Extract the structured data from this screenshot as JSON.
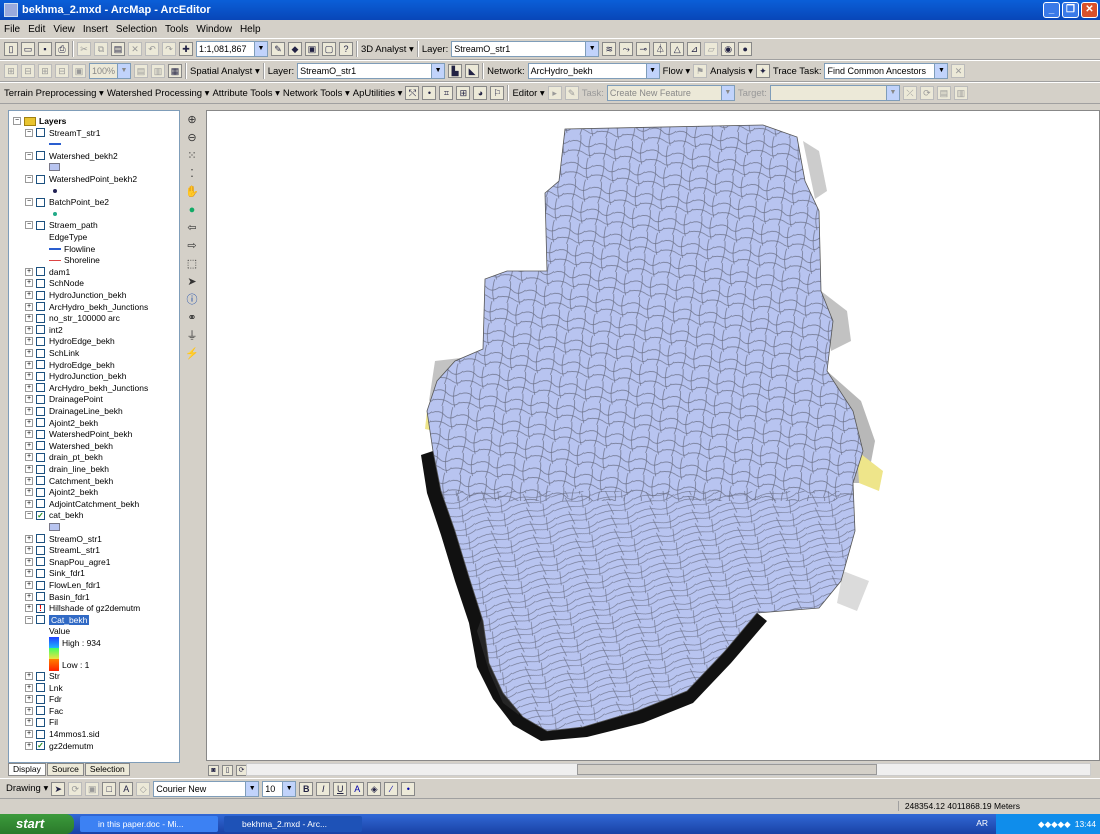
{
  "window": {
    "title": "bekhma_2.mxd - ArcMap - ArcEditor"
  },
  "menu": [
    "File",
    "Edit",
    "View",
    "Insert",
    "Selection",
    "Tools",
    "Window",
    "Help"
  ],
  "toolbar1": {
    "scale": "1:1,081,867",
    "analyst3d": "3D Analyst ▾",
    "layer_label": "Layer:",
    "layer_value": "StreamO_str1"
  },
  "toolbar2": {
    "zoom": "100%",
    "spatial_analyst": "Spatial Analyst ▾",
    "layer_label": "Layer:",
    "layer_value": "StreamO_str1",
    "network_label": "Network:",
    "network_value": "ArcHydro_bekh",
    "flow": "Flow ▾",
    "analysis": "Analysis ▾",
    "trace_label": "Trace Task:",
    "trace_value": "Find Common Ancestors"
  },
  "toolbar3": {
    "terrain": "Terrain Preprocessing ▾",
    "watershed": "Watershed Processing ▾",
    "attribute": "Attribute Tools ▾",
    "network": "Network Tools ▾",
    "aputilities": "ApUtilities ▾",
    "editor": "Editor ▾",
    "task_label": "Task:",
    "task_value": "Create New Feature",
    "target_label": "Target:"
  },
  "toc": {
    "rows": [
      {
        "t": "root",
        "label": "Layers",
        "exp": "−"
      },
      {
        "t": "layer",
        "label": "StreamT_str1",
        "exp": "−",
        "chk": ""
      },
      {
        "t": "sym",
        "label": "",
        "sym": "line-blue"
      },
      {
        "t": "layer",
        "label": "Watershed_bekh2",
        "exp": "−",
        "chk": ""
      },
      {
        "t": "sym",
        "label": "",
        "sym": "box-blue"
      },
      {
        "t": "layer",
        "label": "WatershedPoint_bekh2",
        "exp": "−",
        "chk": ""
      },
      {
        "t": "sym",
        "label": "",
        "sym": "dot"
      },
      {
        "t": "layer",
        "label": "BatchPoint_be2",
        "exp": "−",
        "chk": ""
      },
      {
        "t": "sym",
        "label": "",
        "sym": "dot-green"
      },
      {
        "t": "layer",
        "label": "Straem_path",
        "exp": "−",
        "chk": ""
      },
      {
        "t": "sub",
        "label": "EdgeType"
      },
      {
        "t": "sym",
        "label": "Flowline",
        "sym": "line-blue"
      },
      {
        "t": "sym",
        "label": "Shoreline",
        "sym": "line-red"
      },
      {
        "t": "layer",
        "label": "dam1",
        "exp": "+",
        "chk": ""
      },
      {
        "t": "layer",
        "label": "SchNode",
        "exp": "+",
        "chk": ""
      },
      {
        "t": "layer",
        "label": "HydroJunction_bekh",
        "exp": "+",
        "chk": ""
      },
      {
        "t": "layer",
        "label": "ArcHydro_bekh_Junctions",
        "exp": "+",
        "chk": ""
      },
      {
        "t": "layer",
        "label": "no_str_100000 arc",
        "exp": "+",
        "chk": ""
      },
      {
        "t": "layer",
        "label": "int2",
        "exp": "+",
        "chk": ""
      },
      {
        "t": "layer",
        "label": "HydroEdge_bekh",
        "exp": "+",
        "chk": ""
      },
      {
        "t": "layer",
        "label": "SchLink",
        "exp": "+",
        "chk": ""
      },
      {
        "t": "layer",
        "label": "HydroEdge_bekh",
        "exp": "+",
        "chk": ""
      },
      {
        "t": "layer",
        "label": "HydroJunction_bekh",
        "exp": "+",
        "chk": ""
      },
      {
        "t": "layer",
        "label": "ArcHydro_bekh_Junctions",
        "exp": "+",
        "chk": ""
      },
      {
        "t": "layer",
        "label": "DrainagePoint",
        "exp": "+",
        "chk": ""
      },
      {
        "t": "layer",
        "label": "DrainageLine_bekh",
        "exp": "+",
        "chk": ""
      },
      {
        "t": "layer",
        "label": "Ajoint2_bekh",
        "exp": "+",
        "chk": ""
      },
      {
        "t": "layer",
        "label": "WatershedPoint_bekh",
        "exp": "+",
        "chk": ""
      },
      {
        "t": "layer",
        "label": "Watershed_bekh",
        "exp": "+",
        "chk": ""
      },
      {
        "t": "layer",
        "label": "drain_pt_bekh",
        "exp": "+",
        "chk": ""
      },
      {
        "t": "layer",
        "label": "drain_line_bekh",
        "exp": "+",
        "chk": ""
      },
      {
        "t": "layer",
        "label": "Catchment_bekh",
        "exp": "+",
        "chk": ""
      },
      {
        "t": "layer",
        "label": "Ajoint2_bekh",
        "exp": "+",
        "chk": ""
      },
      {
        "t": "layer",
        "label": "AdjointCatchment_bekh",
        "exp": "+",
        "chk": ""
      },
      {
        "t": "layer",
        "label": "cat_bekh",
        "exp": "−",
        "chk": "✓"
      },
      {
        "t": "sym",
        "label": "",
        "sym": "box-blue"
      },
      {
        "t": "layer",
        "label": "StreamO_str1",
        "exp": "+",
        "chk": ""
      },
      {
        "t": "layer",
        "label": "StreamL_str1",
        "exp": "+",
        "chk": ""
      },
      {
        "t": "layer",
        "label": "SnapPou_agre1",
        "exp": "+",
        "chk": ""
      },
      {
        "t": "layer",
        "label": "Sink_fdr1",
        "exp": "+",
        "chk": ""
      },
      {
        "t": "layer",
        "label": "FlowLen_fdr1",
        "exp": "+",
        "chk": ""
      },
      {
        "t": "layer",
        "label": "Basin_fdr1",
        "exp": "+",
        "chk": ""
      },
      {
        "t": "layer",
        "label": "Hillshade of gz2demutm",
        "exp": "+",
        "chk": "!"
      },
      {
        "t": "layer",
        "label": "Cat_bekh",
        "exp": "−",
        "chk": "",
        "sel": true
      },
      {
        "t": "sub",
        "label": "Value"
      },
      {
        "t": "ramp",
        "label": "High : 934"
      },
      {
        "t": "ramp2",
        "label": ""
      },
      {
        "t": "ramp3",
        "label": "Low : 1"
      },
      {
        "t": "layer",
        "label": "Str",
        "exp": "+",
        "chk": ""
      },
      {
        "t": "layer",
        "label": "Lnk",
        "exp": "+",
        "chk": ""
      },
      {
        "t": "layer",
        "label": "Fdr",
        "exp": "+",
        "chk": ""
      },
      {
        "t": "layer",
        "label": "Fac",
        "exp": "+",
        "chk": ""
      },
      {
        "t": "layer",
        "label": "Fil",
        "exp": "+",
        "chk": ""
      },
      {
        "t": "layer",
        "label": "14mmos1.sid",
        "exp": "+",
        "chk": ""
      },
      {
        "t": "layer",
        "label": "gz2demutm",
        "exp": "+",
        "chk": "✓"
      }
    ]
  },
  "tabs": [
    "Display",
    "Source",
    "Selection"
  ],
  "draw": {
    "drawing": "Drawing ▾",
    "font": "Courier New",
    "size": "10"
  },
  "status": {
    "coords": "248354.12  4011868.19 Meters"
  },
  "taskbar": {
    "start": "start",
    "tasks": [
      "in this paper.doc - Mi...",
      "bekhma_2.mxd - Arc..."
    ],
    "lang": "AR",
    "time": "13:44"
  },
  "colors": {
    "catchment_fill": "#b8c4f0",
    "catchment_line": "#6a6f86"
  }
}
